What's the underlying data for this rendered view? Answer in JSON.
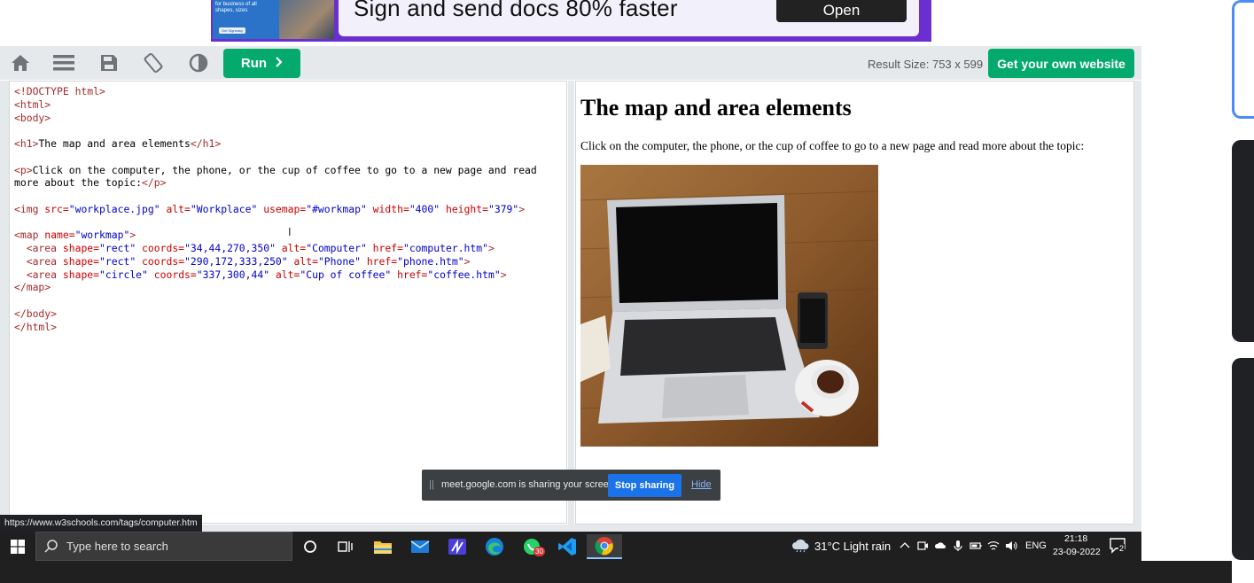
{
  "ad": {
    "small_text": "for business of all shapes, sizes",
    "chip": "Get Signeasy",
    "headline": "Sign and send docs 80% faster",
    "button": "Open"
  },
  "toolbar": {
    "run_label": "Run",
    "result_size": "Result Size: 753 x 599",
    "get_site_label": "Get your own website"
  },
  "code_lines": [
    [
      [
        "tg",
        "<!DOCTYPE html>"
      ]
    ],
    [
      [
        "tg",
        "<html>"
      ]
    ],
    [
      [
        "tg",
        "<body>"
      ]
    ],
    [],
    [
      [
        "tg",
        "<h1>"
      ],
      [
        "tx",
        "The map and area elements"
      ],
      [
        "tg",
        "</h1>"
      ]
    ],
    [],
    [
      [
        "tg",
        "<p>"
      ],
      [
        "tx",
        "Click on the computer, the phone, or the cup of coffee to go to a new page and read"
      ]
    ],
    [
      [
        "tx",
        "more about the topic:"
      ],
      [
        "tg",
        "</p>"
      ]
    ],
    [],
    [
      [
        "tg",
        "<img "
      ],
      [
        "at",
        "src="
      ],
      [
        "vl",
        "\"workplace.jpg\""
      ],
      [
        "at",
        " alt="
      ],
      [
        "vl",
        "\"Workplace\""
      ],
      [
        "at",
        " usemap="
      ],
      [
        "vl",
        "\"#workmap\""
      ],
      [
        "at",
        " width="
      ],
      [
        "vl",
        "\"400\""
      ],
      [
        "at",
        " height="
      ],
      [
        "vl",
        "\"379\""
      ],
      [
        "tg",
        ">"
      ]
    ],
    [],
    [
      [
        "tg",
        "<map "
      ],
      [
        "at",
        "name="
      ],
      [
        "vl",
        "\"workmap\""
      ],
      [
        "tg",
        ">"
      ]
    ],
    [
      [
        "tx",
        "  "
      ],
      [
        "tg",
        "<area "
      ],
      [
        "at",
        "shape="
      ],
      [
        "vl",
        "\"rect\""
      ],
      [
        "at",
        " coords="
      ],
      [
        "vl",
        "\"34,44,270,350\""
      ],
      [
        "at",
        " alt="
      ],
      [
        "vl",
        "\"Computer\""
      ],
      [
        "at",
        " href="
      ],
      [
        "vl",
        "\"computer.htm\""
      ],
      [
        "tg",
        ">"
      ]
    ],
    [
      [
        "tx",
        "  "
      ],
      [
        "tg",
        "<area "
      ],
      [
        "at",
        "shape="
      ],
      [
        "vl",
        "\"rect\""
      ],
      [
        "at",
        " coords="
      ],
      [
        "vl",
        "\"290,172,333,250\""
      ],
      [
        "at",
        " alt="
      ],
      [
        "vl",
        "\"Phone\""
      ],
      [
        "at",
        " href="
      ],
      [
        "vl",
        "\"phone.htm\""
      ],
      [
        "tg",
        ">"
      ]
    ],
    [
      [
        "tx",
        "  "
      ],
      [
        "tg",
        "<area "
      ],
      [
        "at",
        "shape="
      ],
      [
        "vl",
        "\"circle\""
      ],
      [
        "at",
        " coords="
      ],
      [
        "vl",
        "\"337,300,44\""
      ],
      [
        "at",
        " alt="
      ],
      [
        "vl",
        "\"Cup of coffee\""
      ],
      [
        "at",
        " href="
      ],
      [
        "vl",
        "\"coffee.htm\""
      ],
      [
        "tg",
        ">"
      ]
    ],
    [
      [
        "tg",
        "</map>"
      ]
    ],
    [],
    [
      [
        "tg",
        "</body>"
      ]
    ],
    [
      [
        "tg",
        "</html>"
      ]
    ]
  ],
  "result": {
    "heading": "The map and area elements",
    "paragraph": "Click on the computer, the phone, or the cup of coffee to go to a new page and read more about the topic:"
  },
  "share_bar": {
    "grip": "||",
    "text": "meet.google.com is sharing your screen.",
    "stop_label": "Stop sharing",
    "hide_label": "Hide"
  },
  "status_url": "https://www.w3schools.com/tags/computer.htm",
  "taskbar": {
    "search_placeholder": "Type here to search",
    "whatsapp_badge": "30",
    "weather": "31°C  Light rain",
    "language": "ENG",
    "time": "21:18",
    "date": "23-09-2022",
    "notification_count": "2"
  },
  "colors": {
    "accent_green": "#04aa6d",
    "tag": "#a52a2a",
    "attribute": "#cc0000",
    "value": "#0000cd",
    "share_blue": "#1a73e8"
  }
}
